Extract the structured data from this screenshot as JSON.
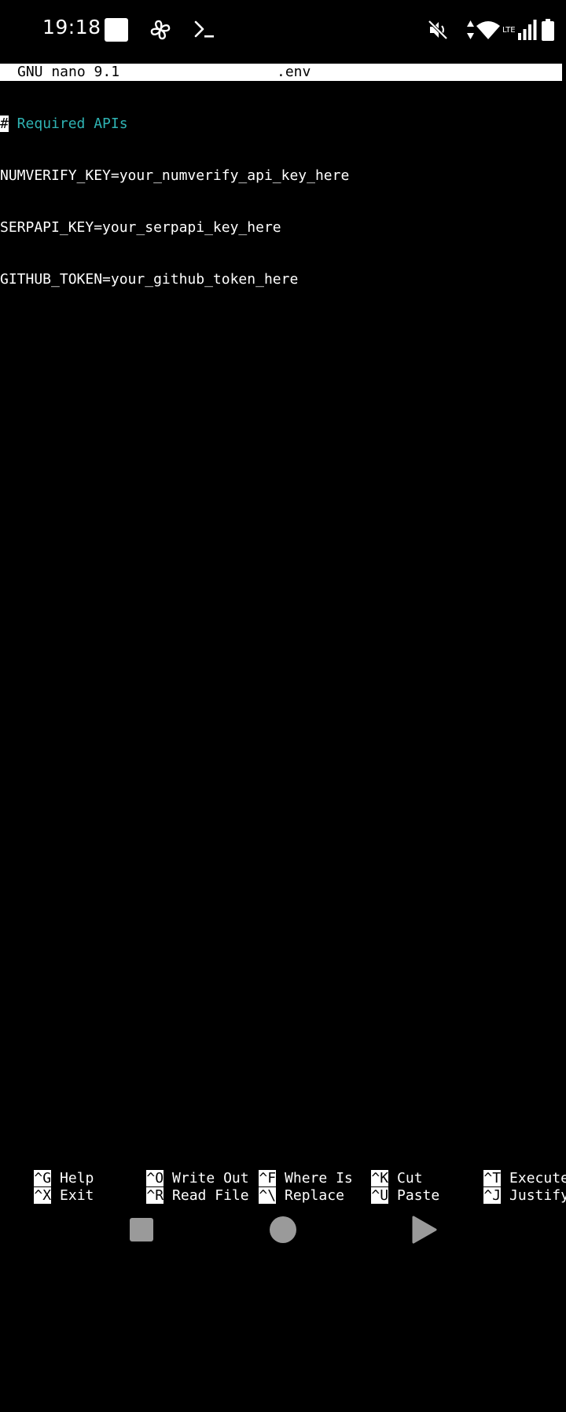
{
  "status_bar": {
    "time": "19:18",
    "network_label": "LTE",
    "icons": [
      "notification-square-icon",
      "fan-icon",
      "terminal-prompt-icon",
      "mute-icon",
      "data-arrows-icon",
      "wifi-icon",
      "signal-icon",
      "battery-icon"
    ]
  },
  "nano": {
    "version": "GNU nano 9.1",
    "filename": ".env",
    "lines": {
      "line1_cursor": "#",
      "line1_comment": " Required APIs",
      "line2": "NUMVERIFY_KEY=your_numverify_api_key_here",
      "line3": "SERPAPI_KEY=your_serpapi_key_here",
      "line4": "GITHUB_TOKEN=your_github_token_here"
    },
    "shortcuts": {
      "help": {
        "key": "^G",
        "label": "Help"
      },
      "exit": {
        "key": "^X",
        "label": "Exit"
      },
      "write_out": {
        "key": "^O",
        "label": "Write Out"
      },
      "read_file": {
        "key": "^R",
        "label": "Read File"
      },
      "where_is": {
        "key": "^F",
        "label": "Where Is"
      },
      "replace": {
        "key": "^\\",
        "label": "Replace"
      },
      "cut": {
        "key": "^K",
        "label": "Cut"
      },
      "paste": {
        "key": "^U",
        "label": "Paste"
      },
      "execute": {
        "key": "^T",
        "label": "Execute"
      },
      "justify": {
        "key": "^J",
        "label": "Justify"
      }
    }
  },
  "colors": {
    "background": "#000000",
    "foreground": "#ffffff",
    "comment": "#2fb3b3",
    "nav_button": "#9a9a9a"
  },
  "nav_bar": {
    "buttons": [
      "back-square-icon",
      "home-circle-icon",
      "recents-triangle-icon"
    ]
  }
}
